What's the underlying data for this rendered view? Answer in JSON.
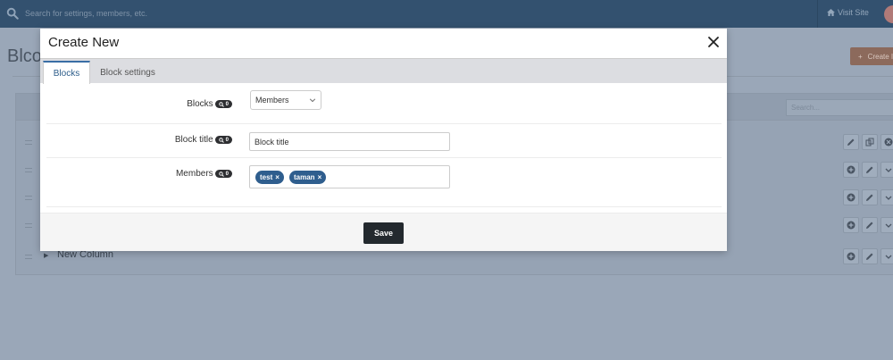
{
  "topbar": {
    "search_placeholder": "Search for settings, members, etc.",
    "visit_site_label": "Visit Site"
  },
  "page": {
    "title": "Blco",
    "create_button_label": "Create I",
    "table_search_placeholder": "Search...",
    "last_row_label": "New Column"
  },
  "modal": {
    "title": "Create New",
    "tabs": [
      {
        "label": "Blocks",
        "active": true
      },
      {
        "label": "Block settings",
        "active": false
      }
    ],
    "fields": {
      "blocks": {
        "label": "Blocks",
        "badge": "0",
        "selected_value": "Members"
      },
      "block_title": {
        "label": "Block title",
        "badge": "0",
        "value": "Block title"
      },
      "members": {
        "label": "Members",
        "badge": "0",
        "tags": [
          "test",
          "taman"
        ]
      }
    },
    "save_label": "Save"
  },
  "colors": {
    "topbar": "#33516f",
    "overlay": "#9aa7b8",
    "tab_accent": "#3a6ea5",
    "tag": "#2f5e8e",
    "save_button": "#23292e"
  }
}
